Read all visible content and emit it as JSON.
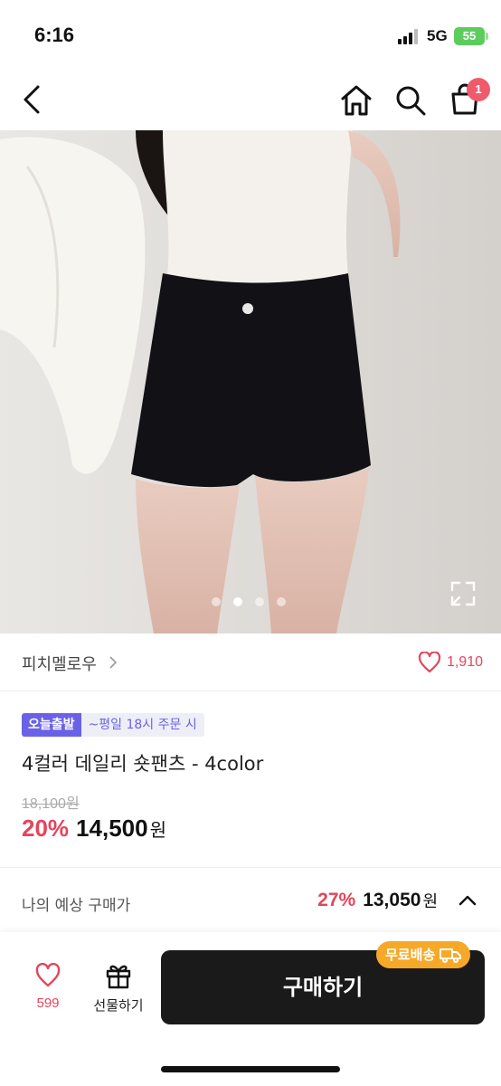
{
  "status_bar": {
    "time": "6:16",
    "network": "5G",
    "battery": "55"
  },
  "nav": {
    "icons": [
      "chevron-left-icon",
      "home-icon",
      "search-icon",
      "shopping-bag-icon"
    ],
    "cart_count": "1"
  },
  "gallery": {
    "slide_count": 4,
    "active_slide": 2
  },
  "brand": {
    "name": "피치멜로우",
    "like_count": "1,910"
  },
  "product": {
    "badge_today": "오늘출발",
    "badge_time": "~평일 18시 주문 시",
    "title": "4컬러 데일리 숏팬츠 - 4color",
    "original_price": "18,100원",
    "discount": "20%",
    "sale_price": "14,500",
    "currency": "원"
  },
  "expected": {
    "label": "나의 예상 구매가",
    "discount": "27%",
    "price": "13,050",
    "currency": "원"
  },
  "bottom_bar": {
    "wish_count": "599",
    "gift_label": "선물하기",
    "buy_label": "구매하기",
    "free_shipping": "무료배송"
  },
  "colors": {
    "accent_red": "#e5455b",
    "badge_purple": "#6a62e6",
    "shipping_orange": "#f6a928",
    "buy_button": "#1a1a1a"
  }
}
